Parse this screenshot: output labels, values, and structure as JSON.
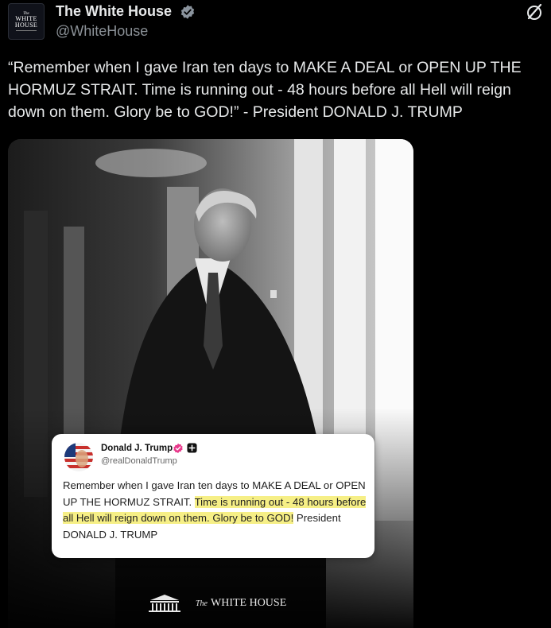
{
  "account": {
    "display_name": "The White House",
    "handle": "@WhiteHouse",
    "avatar_top": "The",
    "avatar_line1": "WHITE",
    "avatar_line2": "HOUSE",
    "verified_color": "#8b949e"
  },
  "tweet": {
    "text": "“Remember when I gave Iran ten days to MAKE A DEAL or OPEN UP THE HORMUZ STRAIT. Time is running out - 48 hours before all Hell will reign down on them. Glory be to GOD!” - President DONALD J. TRUMP"
  },
  "quoted_post": {
    "name": "Donald J. Trump",
    "handle": "@realDonaldTrump",
    "text_plain": "Remember when I gave Iran ten days to MAKE A DEAL or OPEN UP THE HORMUZ STRAIT.",
    "text_highlight_1": "Time is running out - 48 hours before all Hell will reign down on them. Glory be to GOD!",
    "text_tail": "President DONALD J. TRUMP",
    "highlight_color": "#f6ef86",
    "verified_color": "#e83a8c"
  },
  "footer": {
    "brand_prefix": "The",
    "brand_name": "WHITE HOUSE"
  },
  "icons": {
    "menu": "grok-slash-circle-icon",
    "verified": "verified-badge-icon",
    "quote_plus": "plus-square-icon",
    "flag": "flag-avatar-icon",
    "building": "white-house-building-icon"
  }
}
